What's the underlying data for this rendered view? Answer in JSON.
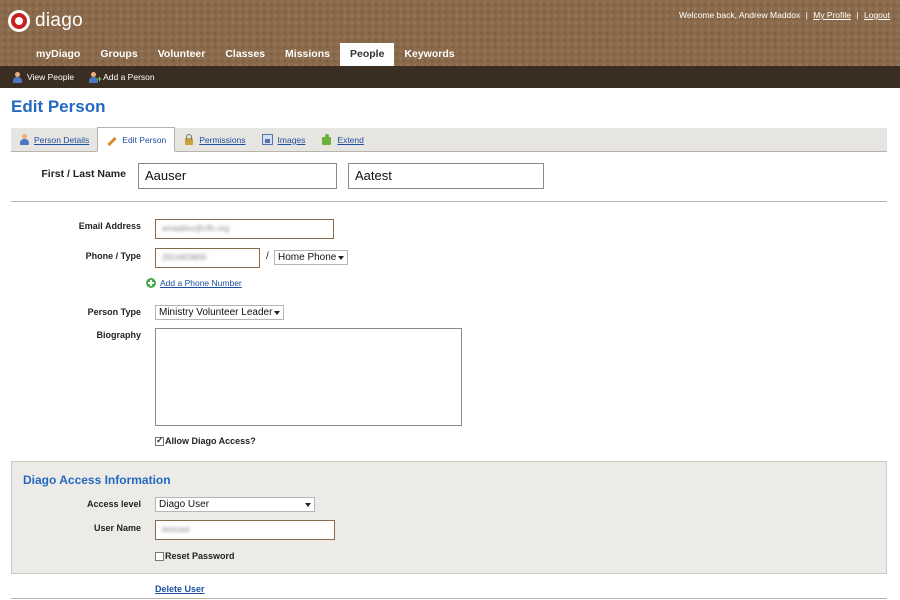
{
  "app": {
    "logo_text": "diago",
    "welcome_text": "Welcome back, Andrew Maddox",
    "profile_link": "My Profile",
    "separator": "|",
    "logout_link": "Logout"
  },
  "main_nav": [
    {
      "label": "myDiago",
      "active": false
    },
    {
      "label": "Groups",
      "active": false
    },
    {
      "label": "Volunteer",
      "active": false
    },
    {
      "label": "Classes",
      "active": false
    },
    {
      "label": "Missions",
      "active": false
    },
    {
      "label": "People",
      "active": true
    },
    {
      "label": "Keywords",
      "active": false
    }
  ],
  "sub_nav": {
    "view_people": "View People",
    "add_person": "Add a Person"
  },
  "page": {
    "title": "Edit Person"
  },
  "tabs": [
    {
      "label": "Person Details",
      "icon": "person-icon",
      "active": false
    },
    {
      "label": "Edit Person",
      "icon": "pencil-icon",
      "active": true
    },
    {
      "label": "Permissions",
      "icon": "lock-icon",
      "active": false
    },
    {
      "label": "Images",
      "icon": "images-icon",
      "active": false
    },
    {
      "label": "Extend",
      "icon": "puzzle-icon",
      "active": false
    }
  ],
  "form": {
    "name_label": "First / Last Name",
    "first_name": "Aauser",
    "last_name": "Aatest",
    "email_label": "Email Address",
    "email_value": "amaddox@cffc.org",
    "phone_label": "Phone / Type",
    "phone_value": "2814403800",
    "phone_slash": "/",
    "phone_type": "Home Phone",
    "add_phone": "Add a Phone Number",
    "person_type_label": "Person Type",
    "person_type": "Ministry Volunteer Leader",
    "biography_label": "Biography",
    "biography_value": "",
    "allow_access_label": "Allow Diago Access?",
    "allow_access_checked": true
  },
  "access": {
    "section_title": "Diago Access Information",
    "access_level_label": "Access level",
    "access_level": "Diago User",
    "username_label": "User Name",
    "username_value": "testuser",
    "reset_password_label": "Reset Password",
    "reset_password_checked": false
  },
  "footer": {
    "delete_user": "Delete User"
  },
  "colors": {
    "header_brown": "#8a6a4a",
    "subnav_dark": "#3a2d22",
    "title_blue": "#2469c0",
    "link_blue": "#1f4fa0",
    "logo_red": "#c8201e"
  }
}
